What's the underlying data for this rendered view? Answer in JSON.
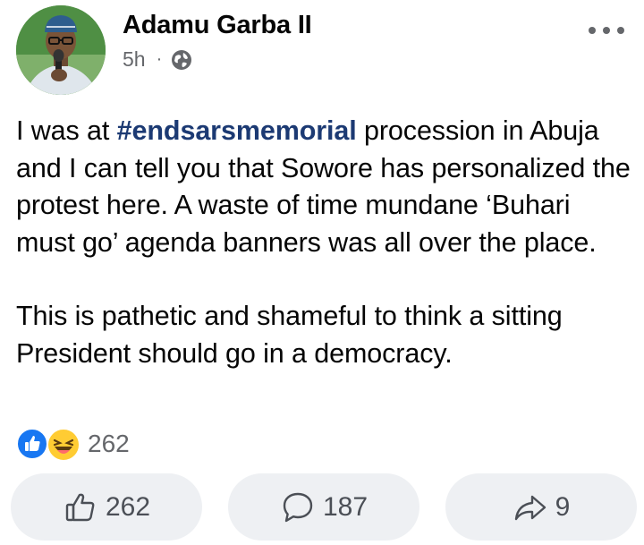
{
  "post": {
    "author": "Adamu Garba II",
    "time": "5h",
    "dot": "·",
    "privacy_icon": "globe-icon",
    "more_icon": "more-horizontal-icon",
    "body": {
      "p1_before": "I was at ",
      "hashtag": "#endsarsmemorial",
      "p1_after": " procession in Abuja and I can tell you that Sowore has personalized the protest here. A waste of time mundane ‘Buhari must go’ agenda banners was all over the place.",
      "p2": "This is pathetic and shameful to think a sitting President should go in a democracy."
    },
    "reactions": {
      "icons": [
        "like-icon",
        "haha-icon"
      ],
      "count": "262"
    },
    "actions": {
      "like_count": "262",
      "comment_count": "187",
      "share_count": "9"
    }
  },
  "colors": {
    "hashtag": "#1c3a73",
    "like_blue": "#1877f2",
    "haha_yellow": "#ffcc33",
    "button_bg": "#eef0f3",
    "secondary_text": "#65676b"
  }
}
